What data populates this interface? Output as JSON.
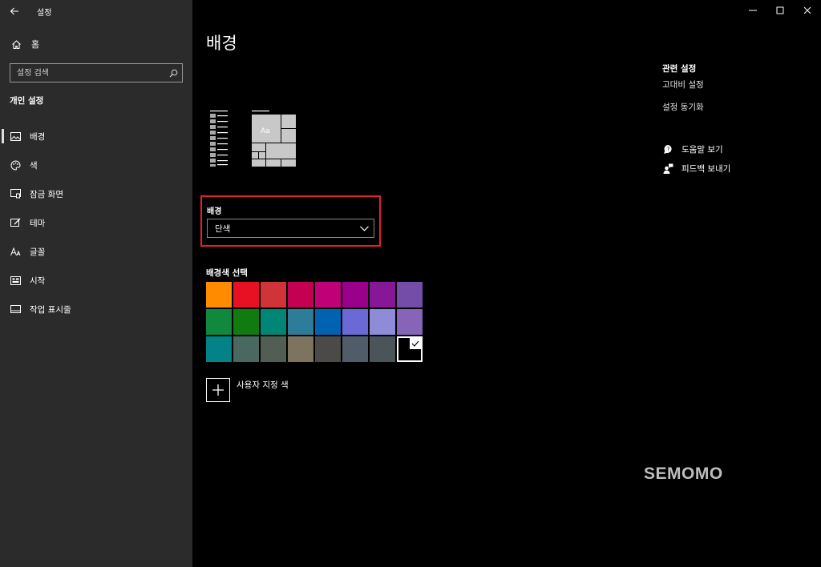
{
  "app": {
    "title": "설정"
  },
  "sidebar": {
    "home_label": "홈",
    "search_placeholder": "설정 검색",
    "section_title": "개인 설정",
    "items": [
      {
        "label": "배경",
        "icon": "image-icon",
        "active": true
      },
      {
        "label": "색",
        "icon": "palette-icon",
        "active": false
      },
      {
        "label": "잠금 화면",
        "icon": "lock-screen-icon",
        "active": false
      },
      {
        "label": "테마",
        "icon": "theme-icon",
        "active": false
      },
      {
        "label": "글꼴",
        "icon": "font-icon",
        "active": false
      },
      {
        "label": "시작",
        "icon": "start-icon",
        "active": false
      },
      {
        "label": "작업 표시줄",
        "icon": "taskbar-icon",
        "active": false
      }
    ]
  },
  "main": {
    "page_title": "배경",
    "preview_tile_text": "Aa",
    "background_label": "배경",
    "background_value": "단색",
    "color_title": "배경색 선택",
    "colors": [
      "#ff8c00",
      "#e81123",
      "#d13438",
      "#c30052",
      "#bf0077",
      "#9a0089",
      "#881798",
      "#744da9",
      "#10893e",
      "#107c10",
      "#018574",
      "#2d7d9a",
      "#0063b1",
      "#6b69d6",
      "#8e8cd8",
      "#8764b8",
      "#038387",
      "#486860",
      "#525e54",
      "#7e735f",
      "#4c4a48",
      "#515c6b",
      "#4a5459",
      "#000000"
    ],
    "selected_color_index": 23,
    "custom_color_label": "사용자 지정 색"
  },
  "related": {
    "title": "관련 설정",
    "links": [
      "고대비 설정",
      "설정 동기화"
    ]
  },
  "help": {
    "get_help": "도움말 보기",
    "give_feedback": "피드백 보내기"
  },
  "watermark": "SEMOMO"
}
